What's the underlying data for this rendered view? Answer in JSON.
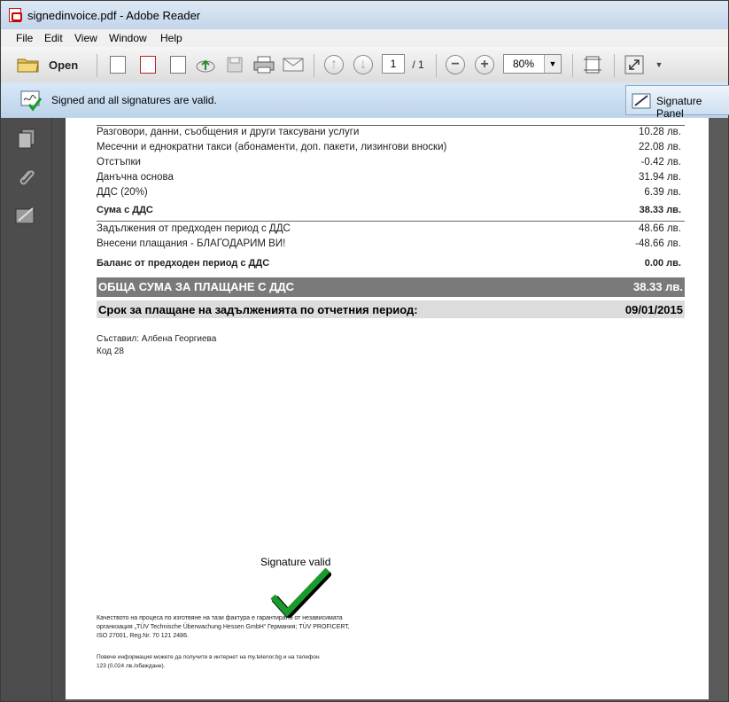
{
  "window": {
    "title": "signedinvoice.pdf - Adobe Reader"
  },
  "menu": [
    "File",
    "Edit",
    "View",
    "Window",
    "Help"
  ],
  "toolbar": {
    "open_label": "Open",
    "page_current": "1",
    "page_total": "/ 1",
    "zoom": "80%"
  },
  "signature_bar": {
    "message": "Signed and all signatures are valid.",
    "panel_button": "Signature Panel"
  },
  "invoice": {
    "rows": [
      {
        "label": "Разговори, данни, съобщения и други таксувани услуги",
        "value": "10.28 лв."
      },
      {
        "label": "Месечни и еднократни такси (абонаменти, доп. пакети, лизингови вноски)",
        "value": "22.08 лв."
      },
      {
        "label": "Отстъпки",
        "value": "-0.42 лв."
      },
      {
        "label": "Данъчна основа",
        "value": "31.94 лв."
      },
      {
        "label": "ДДС (20%)",
        "value": "6.39 лв."
      }
    ],
    "sum_label": "Сума с ДДС",
    "sum_value": "38.33 лв.",
    "prev_rows": [
      {
        "label": "Задължения от предходен период с ДДС",
        "value": "48.66 лв."
      },
      {
        "label": "Внесени плащания - БЛАГОДАРИМ ВИ!",
        "value": "-48.66 лв."
      }
    ],
    "balance_label": "Баланс от предходен период с ДДС",
    "balance_value": "0.00 лв.",
    "total_label": "ОБЩА СУМА ЗА ПЛАЩАНЕ С ДДС",
    "total_value": "38.33 лв.",
    "due_label": "Срок за плащане на задълженията по отчетния период:",
    "due_value": "09/01/2015",
    "prepared_by": "Съставил: Албена Георгиева",
    "code": "Код 28",
    "signature_text": "Signature valid",
    "footer_quality": "Качеството на процеса по изготвяне на тази фактура е гарантирано от независимата организация „TÜV Technische Überwachung Hessen GmbH“ Германия; TÜV PROFICERT, ISO 27001, Reg.Nr. 70 121 2486.",
    "footer_info": "Повече информация можете да получите в интернет на my.telenor.bg и на телефон 123 (0,024 лв./обаждане)."
  },
  "colors": {
    "check": "#1a9a2a",
    "total_bg": "#7a7a7a",
    "due_bg": "#dcdcdc"
  }
}
